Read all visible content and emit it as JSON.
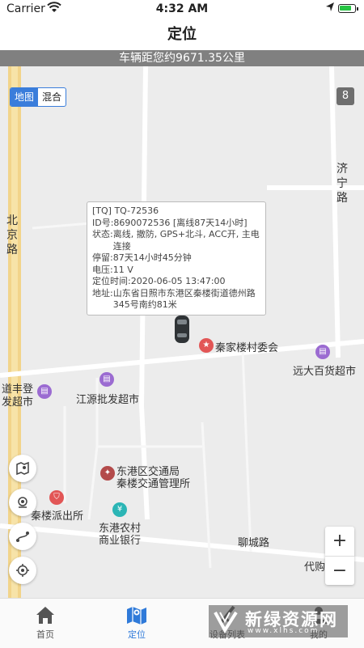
{
  "status_bar": {
    "carrier": "Carrier",
    "time": "4:32 AM",
    "battery_level": 0.85
  },
  "header": {
    "title": "定位"
  },
  "distance_banner": "车辆距您约9671.35公里",
  "map": {
    "type_toggle": {
      "options": [
        "地图",
        "混合"
      ],
      "selected": "地图"
    },
    "route_badge": "8",
    "roads": {
      "beijing_road": [
        "北",
        "京",
        "路"
      ],
      "jining_road": [
        "济",
        "宁",
        "路"
      ],
      "liaocheng_road": "聊城路"
    },
    "info_window": {
      "title": "[TQ] TQ-72536",
      "rows": [
        {
          "key": "ID号:",
          "value": "8690072536 [离线87天14小时]"
        },
        {
          "key": "状态:",
          "value": "离线, 撤防, GPS+北斗, ACC开, 主电连接"
        },
        {
          "key": "停留:",
          "value": "87天14小时45分钟"
        },
        {
          "key": "电压:",
          "value": "11 V"
        },
        {
          "key": "定位时间:",
          "value": "2020-06-05 13:47:00"
        },
        {
          "key": "地址:",
          "value": "山东省日照市东港区秦楼街道德州路345号南约81米"
        }
      ]
    },
    "pois": [
      {
        "name": "秦家楼村委会",
        "icon": "star-marker-icon"
      },
      {
        "name": "远大百货超市",
        "icon": "shop-icon"
      },
      {
        "name": "道丰登",
        "icon": "shop-icon"
      },
      {
        "name": "发超市",
        "icon": "shop-icon"
      },
      {
        "name": "江源批发超市",
        "icon": "shop-icon"
      },
      {
        "name": "东港区交通局",
        "icon": "government-icon"
      },
      {
        "name": "秦楼交通管理所",
        "icon": "government-icon"
      },
      {
        "name": "秦楼派出所",
        "icon": "police-icon"
      },
      {
        "name": "东港农村",
        "icon": "bank-icon"
      },
      {
        "name": "商业银行",
        "icon": "bank-icon"
      },
      {
        "name": "代购",
        "icon": "shop-icon"
      }
    ],
    "controls": [
      "map-layers-icon",
      "street-view-icon",
      "track-icon",
      "locate-icon"
    ],
    "zoom": {
      "in": "+",
      "out": "−"
    }
  },
  "tabs": [
    {
      "label": "首页",
      "icon": "home-icon",
      "active": false
    },
    {
      "label": "定位",
      "icon": "map-icon",
      "active": true
    },
    {
      "label": "设备列表",
      "icon": "list-icon",
      "active": false
    },
    {
      "label": "我的",
      "icon": "user-icon",
      "active": false
    }
  ],
  "watermark": {
    "title": "新绿资源网",
    "url": "www.xlhs.com"
  },
  "colors": {
    "accent": "#2f7ad9",
    "banner": "#808080",
    "map_bg": "#ececec",
    "highway": "#f2d48a"
  }
}
